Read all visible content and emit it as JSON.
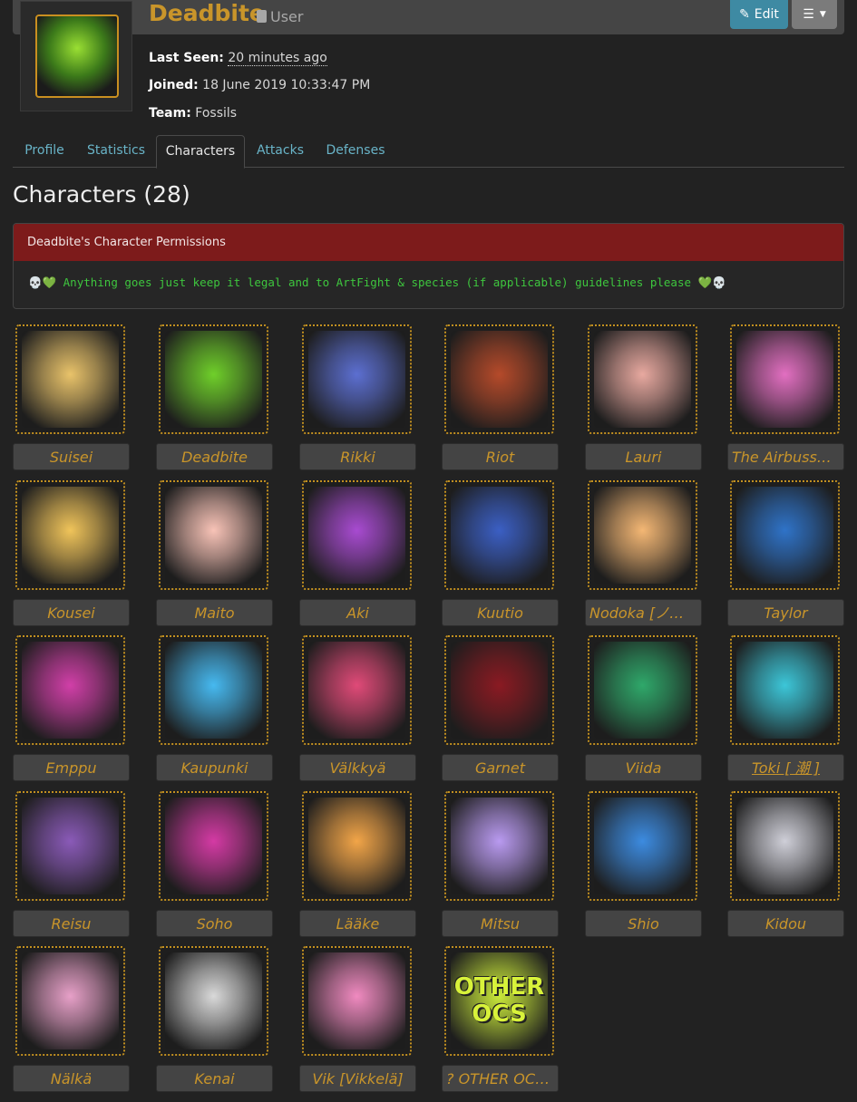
{
  "header": {
    "username": "Deadbite",
    "role": "User",
    "edit_label": "Edit",
    "menu_icon": "hamburger-icon"
  },
  "profile": {
    "last_seen_label": "Last Seen:",
    "last_seen_value": "20 minutes ago",
    "joined_label": "Joined:",
    "joined_value": "18 June 2019 10:33:47 PM",
    "team_label": "Team:",
    "team_value": "Fossils"
  },
  "tabs": [
    "Profile",
    "Statistics",
    "Characters",
    "Attacks",
    "Defenses"
  ],
  "active_tab": "Characters",
  "page_title": "Characters (28)",
  "permissions": {
    "title": "Deadbite's Character Permissions",
    "text": "💀💚 Anything goes just keep it legal and to ArtFight & species (if applicable) guidelines please 💚💀"
  },
  "characters": [
    {
      "name": "Suisei",
      "color": "#e9c36a"
    },
    {
      "name": "Deadbite",
      "color": "#6fcf2a"
    },
    {
      "name": "Rikki",
      "color": "#5c6fd1"
    },
    {
      "name": "Riot",
      "color": "#b54a2a"
    },
    {
      "name": "Lauri",
      "color": "#e8a9a0"
    },
    {
      "name": "The Airbussy ...",
      "color": "#e26fc1"
    },
    {
      "name": "Kousei",
      "color": "#f0c45a"
    },
    {
      "name": "Maito",
      "color": "#f8c3b7"
    },
    {
      "name": "Aki",
      "color": "#a84bd1"
    },
    {
      "name": "Kuutio",
      "color": "#3b5fc4"
    },
    {
      "name": "Nodoka [ノド...",
      "color": "#f4b774"
    },
    {
      "name": "Taylor",
      "color": "#2f73c8"
    },
    {
      "name": "Emppu",
      "color": "#d13fa8"
    },
    {
      "name": "Kaupunki",
      "color": "#46b9f0"
    },
    {
      "name": "Välkkyä",
      "color": "#e04a78"
    },
    {
      "name": "Garnet",
      "color": "#8a1a22"
    },
    {
      "name": "Viida",
      "color": "#2fa86a"
    },
    {
      "name": "Toki [ 潮 ]",
      "color": "#3cc6d8"
    },
    {
      "name": "Reisu",
      "color": "#8a5ab8"
    },
    {
      "name": "Soho",
      "color": "#d43aa4"
    },
    {
      "name": "Lääke",
      "color": "#f2a548"
    },
    {
      "name": "Mitsu",
      "color": "#b99af0"
    },
    {
      "name": "Shio",
      "color": "#3c8be0"
    },
    {
      "name": "Kidou",
      "color": "#cfcfd8"
    },
    {
      "name": "Nälkä",
      "color": "#e7a0c8"
    },
    {
      "name": "Kenai",
      "color": "#d9d9d9"
    },
    {
      "name": "Vik [Vikkelä]",
      "color": "#f08ac0"
    },
    {
      "name": "? OTHER OCs...",
      "color": "#c9e83a"
    }
  ],
  "other_ocs_overlay": "OTHER OCS"
}
